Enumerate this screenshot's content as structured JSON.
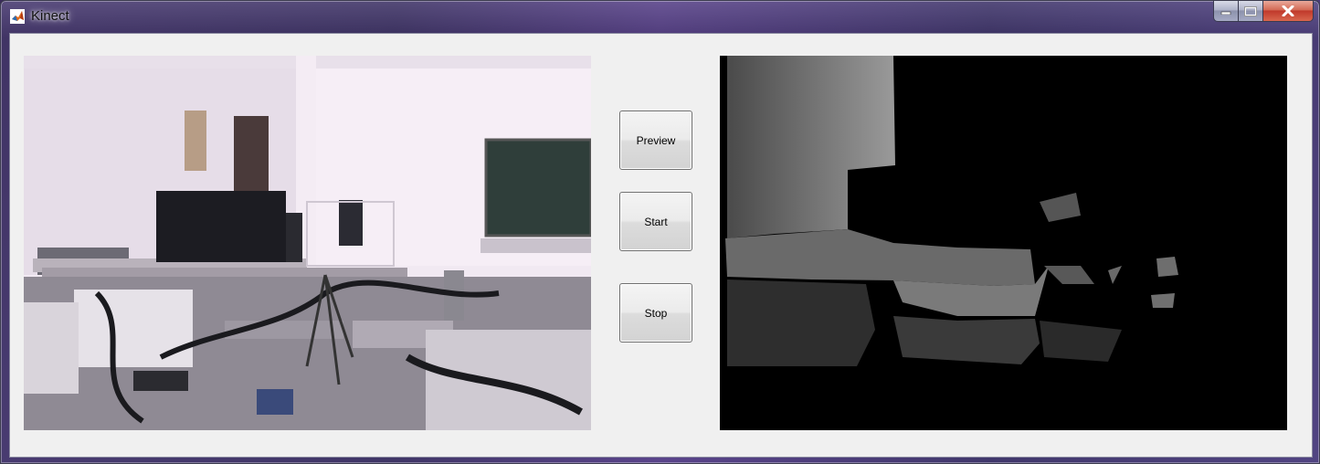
{
  "window": {
    "title": "Kinect"
  },
  "icons": {
    "app": "matlab-logo-icon",
    "minimize": "minimize-icon",
    "maximize": "maximize-icon",
    "close": "close-icon"
  },
  "buttons": {
    "preview": "Preview",
    "start": "Start",
    "stop": "Stop"
  },
  "colors": {
    "client_bg": "#f0f0f0",
    "depth_bg": "#000000"
  }
}
